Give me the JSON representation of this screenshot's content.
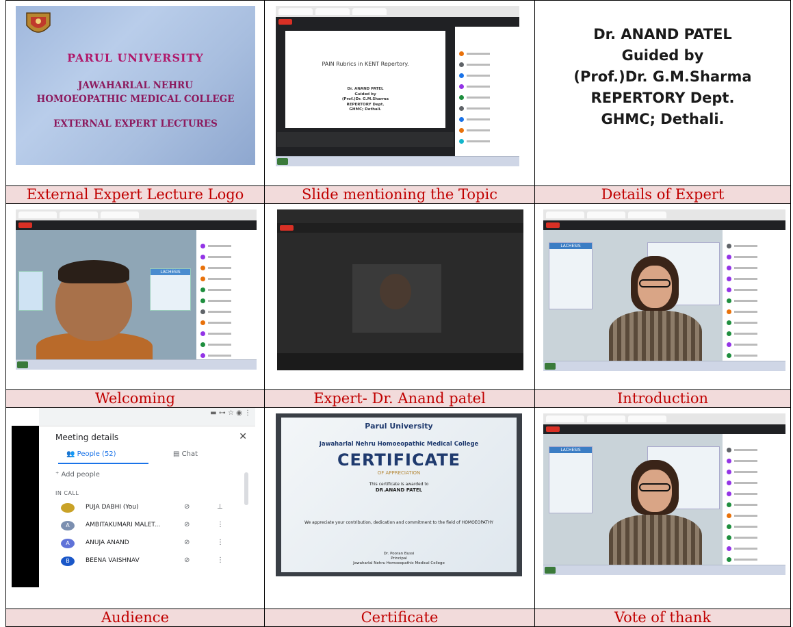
{
  "captions": {
    "c1": "External Expert Lecture Logo",
    "c2": "Slide mentioning the Topic",
    "c3": "Details of Expert",
    "c4": "Welcoming",
    "c5": "Expert- Dr. Anand patel",
    "c6": "Introduction",
    "c7": "Audience",
    "c8": "Certificate",
    "c9": "Vote of thank"
  },
  "logo": {
    "line1": "PARUL UNIVERSITY",
    "line2": "JAWAHARLAL NEHRU",
    "line3": "HOMOEOPATHIC MEDICAL COLLEGE",
    "line4": "EXTERNAL EXPERT LECTURES"
  },
  "slide": {
    "topic": "PAIN Rubrics in KENT Repertory.",
    "details": [
      "Dr. ANAND PATEL",
      "Guided by",
      "(Prof.)Dr. G.M.Sharma",
      "REPERTORY Dept.",
      "GHMC; Dethali."
    ]
  },
  "expert": {
    "line1": "Dr. ANAND PATEL",
    "line2": "Guided by",
    "line3": "(Prof.)Dr. G.M.Sharma",
    "line4": "REPERTORY Dept.",
    "line5": "GHMC; Dethali."
  },
  "posters": {
    "lachesis": "LACHESIS"
  },
  "meeting": {
    "title": "Meeting details",
    "people_tab": "People (52)",
    "chat_tab": "Chat",
    "add_people": "Add people",
    "in_call": "IN CALL",
    "participants": [
      {
        "initial": "",
        "name": "PUJA DABHI (You)"
      },
      {
        "initial": "A",
        "name": "AMBITAKUMARI MALET..."
      },
      {
        "initial": "A",
        "name": "ANUJA ANAND"
      },
      {
        "initial": "B",
        "name": "BEENA VAISHNAV"
      }
    ]
  },
  "certificate": {
    "university": "Parul University",
    "college": "Jawaharlal Nehru Homoeopathic Medical College",
    "title": "CERTIFICATE",
    "subtitle": "OF APPRECIATION",
    "awarded": "This certificate is awarded to",
    "name": "DR.ANAND PATEL",
    "appreciate": "We appreciate your contribution, dedication and commitment to the field of HOMOEOPATHY",
    "signatory": "Dr. Pooran Bussi",
    "signatory_role": "Principal",
    "signatory_org": "Jawaharlal Nehru Homoeopathic Medical College"
  },
  "colors": {
    "caption_bg": "#f2dbdb",
    "caption_text": "#c00000"
  }
}
